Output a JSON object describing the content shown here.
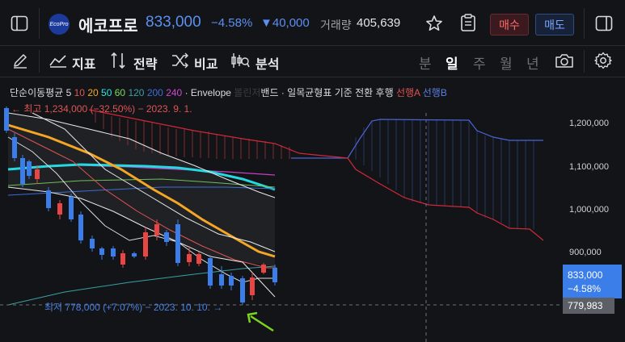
{
  "header": {
    "logo_text": "EcoPro",
    "symbol_name": "에코프로",
    "price": "833,000",
    "change_pct": "−4.58%",
    "change_abs": "▼40,000",
    "volume_label": "거래량",
    "volume_value": "405,639",
    "buy_label": "매수",
    "sell_label": "매도"
  },
  "toolbar": {
    "indicator_label": "지표",
    "strategy_label": "전략",
    "compare_label": "비교",
    "analysis_label": "분석",
    "periods": [
      "분",
      "일",
      "주",
      "월",
      "년"
    ],
    "active_period": "일"
  },
  "legend": {
    "ma_label": "단순이동평균",
    "ma_periods": [
      {
        "text": "5",
        "color": "#d9dbe0"
      },
      {
        "text": "10",
        "color": "#e05454"
      },
      {
        "text": "20",
        "color": "#f5a623"
      },
      {
        "text": "50",
        "color": "#2ee6e6"
      },
      {
        "text": "60",
        "color": "#7ed957"
      },
      {
        "text": "120",
        "color": "#3aa0a8"
      },
      {
        "text": "200",
        "color": "#3b6fd6"
      },
      {
        "text": "240",
        "color": "#d147d1"
      }
    ],
    "envelope_label": "· Envelope",
    "band_label": "볼린저",
    "band_suffix": "밴드",
    "ichimoku_label": "· 일목균형표 기준 전환 후행",
    "span_a": "선행A",
    "span_b": "선행B",
    "high_note": "← 최고 1,234,000 (−32.50%) − 2023. 9. 1.",
    "low_note": "최저 778,000 (+7.07%) − 2023. 10. 10. →"
  },
  "axis": {
    "ticks": [
      "1,200,000",
      "1,100,000",
      "1,000,000",
      "900,000"
    ],
    "last_price": "833,000",
    "last_change": "−4.58%",
    "crosshair_value": "779,983"
  },
  "colors": {
    "up": "#e84545",
    "down": "#3b7de9",
    "accent": "#5b8ff2"
  },
  "icons": [
    "sidebar-left-icon",
    "ecopro-logo-icon",
    "star-icon",
    "clipboard-icon",
    "sidebar-right-icon",
    "pencil-icon",
    "indicator-icon",
    "strategy-icon",
    "compare-icon",
    "analysis-icon",
    "camera-icon",
    "gear-icon"
  ]
}
